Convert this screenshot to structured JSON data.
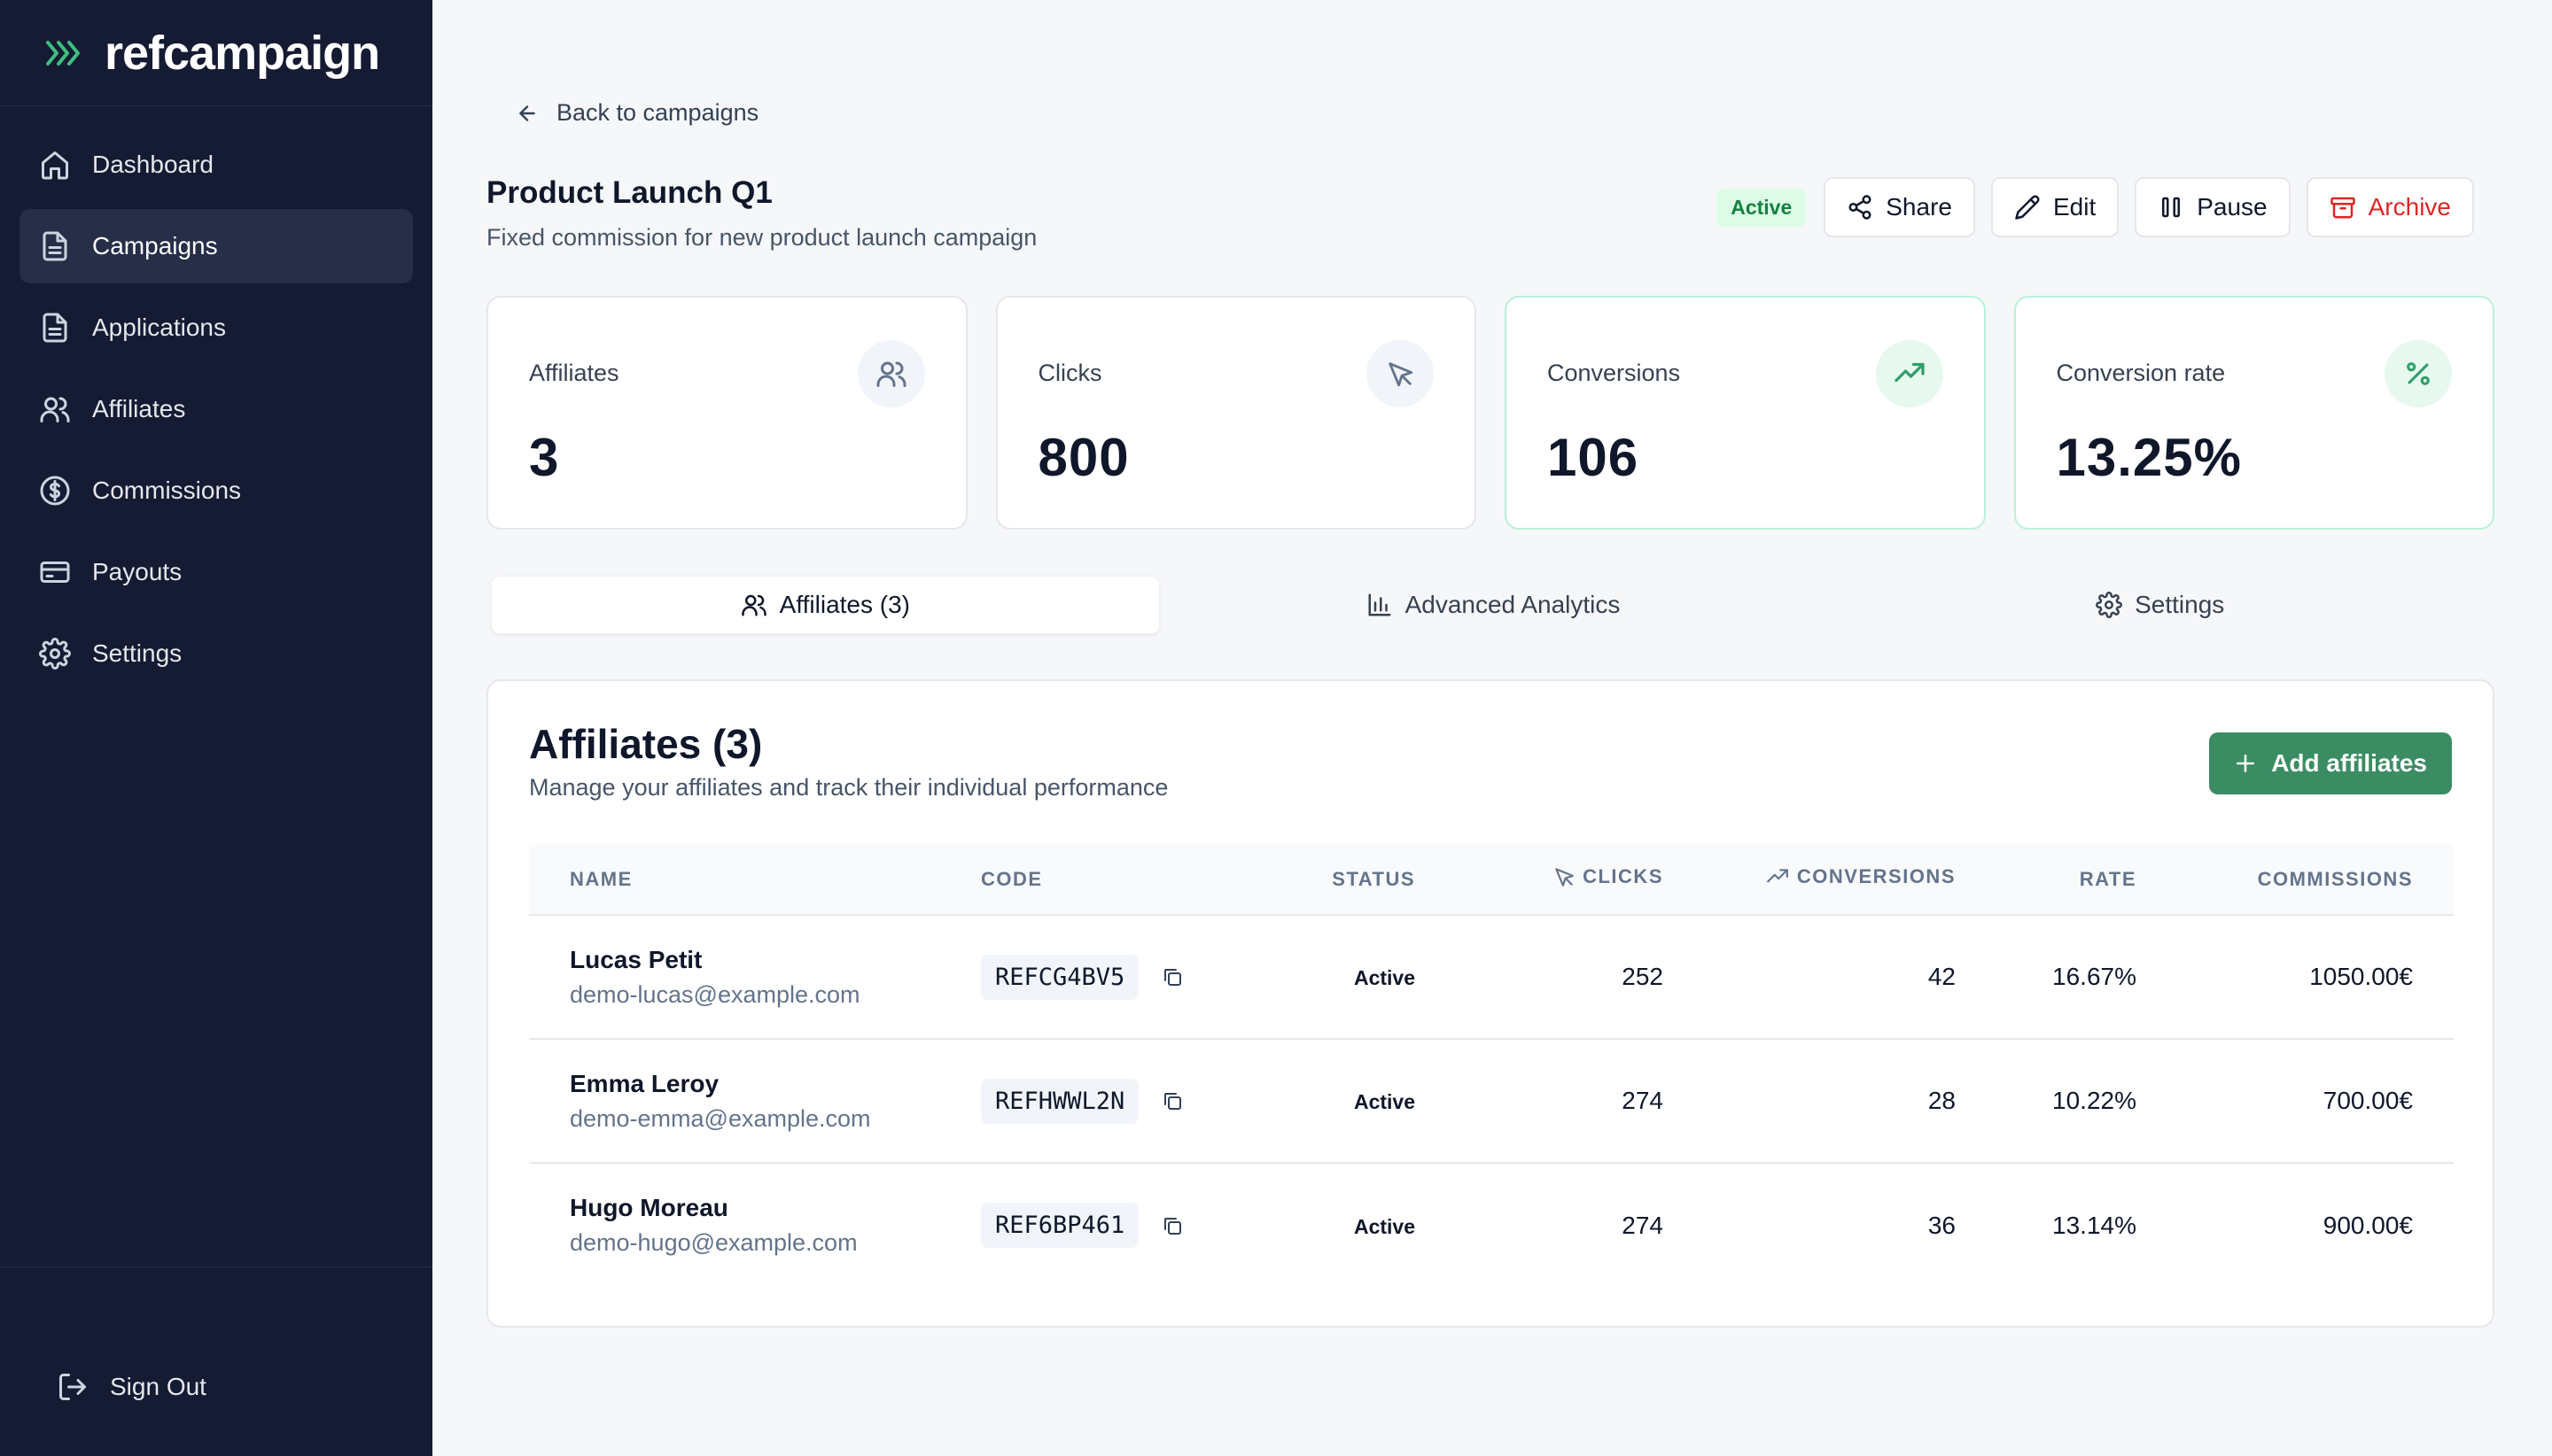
{
  "app": {
    "brand": "refcampaign"
  },
  "sidebar": {
    "items": [
      {
        "label": "Dashboard",
        "icon": "home-icon"
      },
      {
        "label": "Campaigns",
        "icon": "document-icon",
        "active": true
      },
      {
        "label": "Applications",
        "icon": "document-icon"
      },
      {
        "label": "Affiliates",
        "icon": "users-icon"
      },
      {
        "label": "Commissions",
        "icon": "dollar-circle-icon"
      },
      {
        "label": "Payouts",
        "icon": "credit-card-icon"
      },
      {
        "label": "Settings",
        "icon": "gear-icon"
      }
    ],
    "sign_out": "Sign Out"
  },
  "header": {
    "back_label": "Back to campaigns",
    "title": "Product Launch Q1",
    "subtitle": "Fixed commission for new product launch campaign",
    "status_badge": "Active",
    "actions": {
      "share": "Share",
      "edit": "Edit",
      "pause": "Pause",
      "archive": "Archive"
    }
  },
  "stats": [
    {
      "label": "Affiliates",
      "value": "3",
      "icon": "users-icon"
    },
    {
      "label": "Clicks",
      "value": "800",
      "icon": "cursor-icon"
    },
    {
      "label": "Conversions",
      "value": "106",
      "icon": "trending-up-icon"
    },
    {
      "label": "Conversion rate",
      "value": "13.25%",
      "icon": "percent-icon"
    }
  ],
  "tabs": [
    {
      "label": "Affiliates (3)",
      "icon": "users-icon",
      "active": true
    },
    {
      "label": "Advanced Analytics",
      "icon": "bar-chart-icon"
    },
    {
      "label": "Settings",
      "icon": "gear-icon"
    }
  ],
  "affiliates_panel": {
    "title": "Affiliates (3)",
    "subtitle": "Manage your affiliates and track their individual performance",
    "add_button": "Add affiliates",
    "columns": {
      "name": "Name",
      "code": "Code",
      "status": "Status",
      "clicks": "Clicks",
      "conversions": "Conversions",
      "rate": "Rate",
      "commissions": "Commissions"
    },
    "rows": [
      {
        "name": "Lucas Petit",
        "email": "demo-lucas@example.com",
        "code": "REFCG4BV5",
        "status": "Active",
        "clicks": "252",
        "conversions": "42",
        "rate": "16.67%",
        "commissions": "1050.00€"
      },
      {
        "name": "Emma Leroy",
        "email": "demo-emma@example.com",
        "code": "REFHWWL2N",
        "status": "Active",
        "clicks": "274",
        "conversions": "28",
        "rate": "10.22%",
        "commissions": "700.00€"
      },
      {
        "name": "Hugo Moreau",
        "email": "demo-hugo@example.com",
        "code": "REF6BP461",
        "status": "Active",
        "clicks": "274",
        "conversions": "36",
        "rate": "13.14%",
        "commissions": "900.00€"
      }
    ]
  },
  "colors": {
    "sidebar_bg": "#141b33",
    "accent_green": "#3b8c63",
    "rate_green": "#2f9e6b",
    "danger": "#dc2626"
  }
}
